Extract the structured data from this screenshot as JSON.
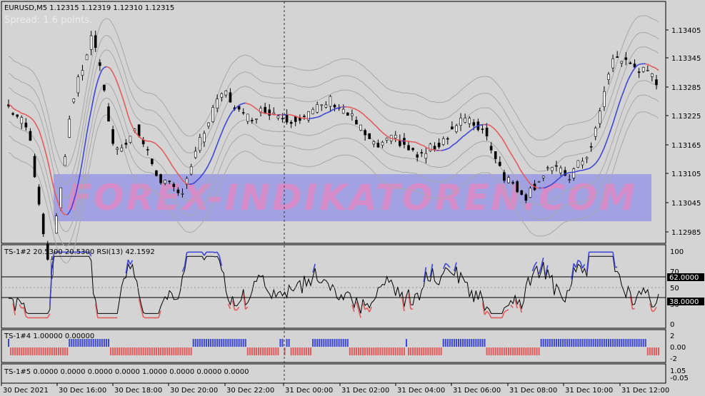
{
  "colors": {
    "background": "#d4d4d4",
    "panel_border": "#000000",
    "candle_up": "#ffffff",
    "candle_down": "#000000",
    "ma_up": "#3b46d6",
    "ma_down": "#e45a5a",
    "envelope": "#a8a8a8",
    "watermark_box": "#8f8fe8",
    "rsi_line": "#000000",
    "rsi_overbought": "#3b46d6",
    "rsi_oversold": "#e45a5a",
    "level_label_bg": "#000000"
  },
  "main": {
    "header": "EURUSD,M5  1.12315 1.12319 1.12310 1.12315",
    "spread": "Spread: 1.6 points.",
    "price_ticks": [
      "1.13405",
      "1.13345",
      "1.13285",
      "1.13225",
      "1.13165",
      "1.13105",
      "1.13045",
      "1.12985"
    ],
    "watermark": "FOREX-INDIKATOREN.COM"
  },
  "sub1": {
    "header": "TS-1#2 20.5300 20.5300  RSI(13) 42.1592",
    "ticks": [
      "100",
      "70",
      "50",
      "30",
      "0"
    ],
    "level_high": "62.0000",
    "level_low": "38.0000"
  },
  "sub2": {
    "header": "TS-1#4 1.00000 0.00000",
    "ticks": [
      "2",
      "0.00",
      "-2"
    ]
  },
  "sub3": {
    "header": "TS-1#5 0.0000 0.0000 0.0000 0.0000 1.0000 0.0000 0.0000 0.0000",
    "ticks": [
      "1.05",
      "-0.05"
    ]
  },
  "time_axis": [
    "30 Dec 2021",
    "30 Dec 16:00",
    "30 Dec 18:00",
    "30 Dec 20:00",
    "30 Dec 22:00",
    "31 Dec 00:00",
    "31 Dec 02:00",
    "31 Dec 04:00",
    "31 Dec 06:00",
    "31 Dec 08:00",
    "31 Dec 10:00",
    "31 Dec 12:00"
  ],
  "chart_data": {
    "type": "line",
    "title": "EURUSD,M5",
    "x": [
      "30 Dec 2021",
      "30 Dec 16:00",
      "30 Dec 18:00",
      "30 Dec 20:00",
      "30 Dec 22:00",
      "31 Dec 00:00",
      "31 Dec 02:00",
      "31 Dec 04:00",
      "31 Dec 06:00",
      "31 Dec 08:00",
      "31 Dec 10:00",
      "31 Dec 12:00"
    ],
    "ylim": [
      1.1296,
      1.1345
    ],
    "series": [
      {
        "values": [
          1.1325,
          1.132,
          1.129,
          1.1325,
          1.134,
          1.1315,
          1.132,
          1.131,
          1.1306,
          1.1318,
          1.1328,
          1.1322,
          1.1324,
          1.1322,
          1.1323,
          1.1326,
          1.1322,
          1.1316,
          1.1318,
          1.1314,
          1.1317,
          1.1322,
          1.132,
          1.131,
          1.1306,
          1.1312,
          1.131,
          1.1316,
          1.1335,
          1.1333,
          1.133
        ]
      }
    ]
  }
}
